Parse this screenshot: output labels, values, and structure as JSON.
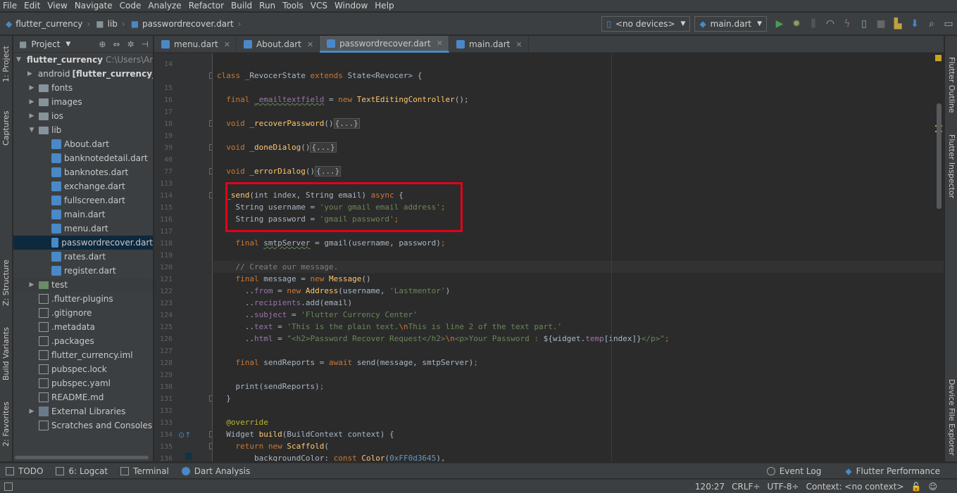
{
  "menu": [
    "File",
    "Edit",
    "View",
    "Navigate",
    "Code",
    "Analyze",
    "Refactor",
    "Build",
    "Run",
    "Tools",
    "VCS",
    "Window",
    "Help"
  ],
  "breadcrumbs": [
    "flutter_currency",
    "lib",
    "passwordrecover.dart"
  ],
  "device_combo": "<no devices>",
  "run_config": "main.dart",
  "project_panel": {
    "title": "Project",
    "root_name": "flutter_currency",
    "root_path": "C:\\Users\\An",
    "android_label": "android",
    "android_module": "[flutter_currency_",
    "items": [
      "fonts",
      "images",
      "ios",
      "lib",
      "About.dart",
      "banknotedetail.dart",
      "banknotes.dart",
      "exchange.dart",
      "fullscreen.dart",
      "main.dart",
      "menu.dart",
      "passwordrecover.dart",
      "rates.dart",
      "register.dart",
      "test",
      ".flutter-plugins",
      ".gitignore",
      ".metadata",
      ".packages",
      "flutter_currency.iml",
      "pubspec.lock",
      "pubspec.yaml",
      "README.md",
      "External Libraries",
      "Scratches and Consoles"
    ]
  },
  "editor_tabs": [
    "menu.dart",
    "About.dart",
    "passwordrecover.dart",
    "main.dart"
  ],
  "line_numbers": [
    "14",
    "15",
    "16",
    "17",
    "18",
    "19",
    "39",
    "40",
    "77",
    "113",
    "114",
    "115",
    "116",
    "117",
    "118",
    "119",
    "120",
    "121",
    "122",
    "123",
    "124",
    "125",
    "126",
    "127",
    "128",
    "129",
    "130",
    "131",
    "132",
    "133",
    "134",
    "135",
    "136"
  ],
  "left_tool_tabs": [
    "1: Project",
    "Captures",
    "Z: Structure",
    "Build Variants",
    "2: Favorites"
  ],
  "right_tool_tabs": [
    "Flutter Outline",
    "Flutter Inspector",
    "Device File Explorer"
  ],
  "bottom_tools": [
    "TODO",
    "6: Logcat",
    "Terminal",
    "Dart Analysis"
  ],
  "bottom_right_tools": [
    "Event Log",
    "Flutter Performance"
  ],
  "status": {
    "position": "120:27",
    "line_sep": "CRLF",
    "encoding": "UTF-8",
    "context": "Context: <no context>"
  },
  "colors": {
    "highlight_box": "#e3001b",
    "selection": "#0d293e",
    "accent": "#4a88c7"
  }
}
